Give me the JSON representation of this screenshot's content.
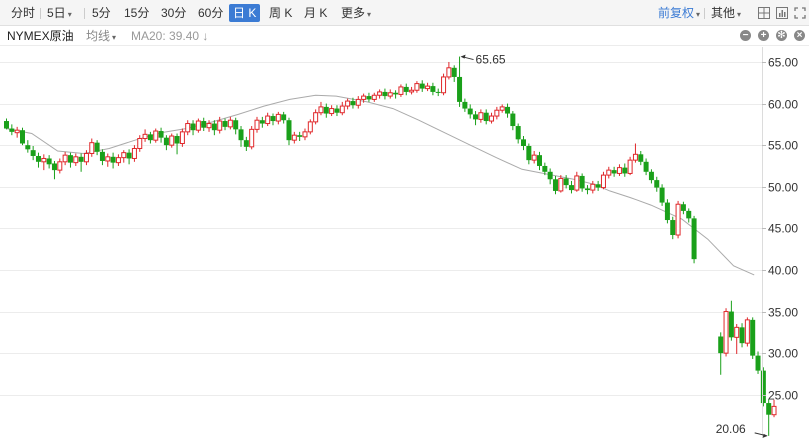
{
  "toolbar": {
    "periods": [
      "分时",
      "5日",
      "5分",
      "15分",
      "30分",
      "60分",
      "日 K",
      "周 K",
      "月 K",
      "更多"
    ],
    "active_period": "日 K",
    "adjust_label": "前复权",
    "other_label": "其他"
  },
  "legend": {
    "symbol": "NYMEX原油",
    "indicator": "均线",
    "ma_label": "MA20: 39.40 ↓"
  },
  "colors": {
    "up": "#e0272a",
    "down": "#1aa01a",
    "ma": "#aaaaaa",
    "accent": "#3b7bd4"
  },
  "chart_data": {
    "type": "candlestick",
    "y_ticks": [
      "65.00",
      "60.00",
      "55.00",
      "50.00",
      "45.00",
      "40.00",
      "35.00",
      "30.00",
      "25.00"
    ],
    "ylim": [
      19.8,
      66.8
    ],
    "grid": true,
    "annotations": {
      "max_label": "65.65",
      "min_label": "20.06"
    },
    "candles": [
      [
        57.9,
        57.0,
        58.2,
        56.9
      ],
      [
        57.0,
        56.6,
        57.5,
        56.2
      ],
      [
        56.5,
        56.8,
        57.2,
        55.9
      ],
      [
        56.8,
        55.2,
        57.1,
        55.0
      ],
      [
        55.0,
        54.5,
        55.6,
        54.1
      ],
      [
        54.4,
        53.7,
        54.9,
        53.2
      ],
      [
        53.7,
        53.0,
        54.1,
        52.3
      ],
      [
        53.0,
        53.4,
        53.9,
        52.0
      ],
      [
        53.4,
        52.7,
        53.8,
        52.2
      ],
      [
        52.8,
        52.0,
        53.1,
        50.9
      ],
      [
        52.0,
        53.0,
        53.4,
        51.6
      ],
      [
        53.0,
        53.8,
        54.2,
        52.6
      ],
      [
        53.8,
        52.9,
        54.1,
        52.3
      ],
      [
        52.9,
        53.6,
        54.0,
        52.5
      ],
      [
        53.6,
        53.0,
        54.0,
        51.8
      ],
      [
        53.0,
        54.0,
        54.4,
        52.6
      ],
      [
        54.0,
        55.3,
        55.8,
        53.6
      ],
      [
        55.3,
        54.2,
        55.6,
        53.8
      ],
      [
        54.2,
        53.1,
        54.5,
        52.6
      ],
      [
        53.1,
        53.6,
        54.0,
        52.4
      ],
      [
        53.6,
        52.9,
        54.1,
        52.2
      ],
      [
        52.9,
        53.5,
        53.9,
        52.5
      ],
      [
        53.5,
        54.1,
        54.4,
        52.9
      ],
      [
        54.1,
        53.4,
        54.5,
        52.7
      ],
      [
        53.4,
        54.6,
        55.0,
        53.0
      ],
      [
        54.6,
        55.8,
        56.2,
        54.2
      ],
      [
        55.8,
        56.3,
        56.9,
        55.4
      ],
      [
        56.3,
        55.6,
        56.6,
        55.2
      ],
      [
        55.6,
        56.7,
        57.0,
        55.3
      ],
      [
        56.7,
        55.9,
        57.1,
        55.3
      ],
      [
        55.9,
        55.0,
        56.2,
        54.4
      ],
      [
        55.0,
        56.1,
        56.4,
        54.7
      ],
      [
        56.1,
        55.2,
        56.4,
        53.9
      ],
      [
        55.2,
        56.6,
        57.0,
        54.8
      ],
      [
        56.6,
        57.6,
        58.0,
        56.2
      ],
      [
        57.6,
        56.8,
        58.0,
        56.2
      ],
      [
        56.8,
        57.9,
        58.2,
        56.5
      ],
      [
        57.9,
        57.1,
        58.3,
        56.7
      ],
      [
        57.1,
        57.6,
        58.0,
        56.6
      ],
      [
        57.6,
        56.8,
        58.0,
        56.2
      ],
      [
        56.8,
        57.9,
        58.4,
        56.4
      ],
      [
        57.9,
        57.2,
        58.2,
        56.8
      ],
      [
        57.2,
        58.0,
        58.4,
        56.9
      ],
      [
        58.0,
        56.9,
        58.3,
        56.3
      ],
      [
        56.9,
        55.6,
        57.3,
        54.8
      ],
      [
        55.6,
        54.8,
        56.0,
        54.3
      ],
      [
        54.8,
        56.9,
        57.3,
        54.5
      ],
      [
        56.9,
        58.0,
        58.4,
        56.5
      ],
      [
        58.0,
        57.6,
        58.4,
        57.1
      ],
      [
        57.6,
        58.5,
        58.9,
        57.3
      ],
      [
        58.5,
        57.9,
        58.8,
        57.4
      ],
      [
        57.9,
        58.7,
        59.0,
        57.5
      ],
      [
        58.7,
        58.0,
        59.0,
        57.6
      ],
      [
        58.0,
        55.6,
        58.3,
        55.0
      ],
      [
        55.6,
        56.2,
        56.6,
        55.2
      ],
      [
        56.2,
        56.0,
        56.6,
        55.5
      ],
      [
        56.0,
        56.6,
        57.0,
        55.6
      ],
      [
        56.6,
        57.8,
        58.1,
        56.3
      ],
      [
        57.8,
        58.9,
        59.3,
        57.5
      ],
      [
        58.9,
        59.6,
        60.2,
        58.6
      ],
      [
        59.6,
        58.8,
        60.0,
        58.3
      ],
      [
        58.8,
        59.4,
        59.8,
        58.5
      ],
      [
        59.4,
        58.9,
        59.8,
        58.5
      ],
      [
        58.9,
        59.7,
        60.2,
        58.6
      ],
      [
        59.7,
        60.3,
        60.6,
        59.3
      ],
      [
        60.3,
        59.8,
        60.7,
        59.4
      ],
      [
        59.8,
        60.5,
        60.9,
        59.4
      ],
      [
        60.5,
        60.9,
        61.2,
        60.1
      ],
      [
        60.9,
        60.5,
        61.3,
        60.2
      ],
      [
        60.5,
        61.0,
        61.3,
        60.2
      ],
      [
        61.0,
        61.4,
        61.7,
        60.6
      ],
      [
        61.4,
        60.9,
        61.8,
        60.5
      ],
      [
        60.9,
        61.3,
        61.7,
        60.6
      ],
      [
        61.3,
        61.1,
        61.6,
        60.6
      ],
      [
        61.1,
        62.0,
        62.3,
        60.8
      ],
      [
        62.0,
        61.4,
        62.4,
        61.0
      ],
      [
        61.4,
        61.6,
        62.0,
        61.1
      ],
      [
        61.6,
        62.4,
        62.7,
        61.3
      ],
      [
        62.4,
        61.8,
        62.8,
        61.4
      ],
      [
        61.8,
        62.1,
        62.5,
        61.5
      ],
      [
        62.1,
        61.4,
        62.5,
        61.0
      ],
      [
        61.4,
        61.3,
        61.8,
        60.9
      ],
      [
        61.3,
        63.2,
        63.6,
        61.0
      ],
      [
        63.2,
        64.3,
        65.0,
        62.9
      ],
      [
        64.3,
        63.2,
        64.6,
        62.6
      ],
      [
        63.2,
        60.2,
        65.65,
        59.6
      ],
      [
        60.2,
        59.4,
        60.6,
        59.0
      ],
      [
        59.4,
        58.7,
        59.9,
        58.2
      ],
      [
        58.7,
        58.1,
        59.1,
        57.4
      ],
      [
        58.1,
        58.9,
        59.3,
        57.7
      ],
      [
        58.9,
        57.9,
        59.3,
        57.5
      ],
      [
        57.9,
        58.5,
        58.9,
        57.6
      ],
      [
        58.5,
        59.2,
        59.6,
        58.1
      ],
      [
        59.2,
        59.6,
        59.9,
        58.9
      ],
      [
        59.6,
        58.8,
        60.0,
        58.3
      ],
      [
        58.8,
        57.3,
        59.1,
        56.8
      ],
      [
        57.3,
        55.7,
        57.6,
        55.2
      ],
      [
        55.7,
        54.9,
        56.1,
        54.4
      ],
      [
        54.9,
        53.2,
        55.2,
        52.7
      ],
      [
        53.2,
        53.8,
        54.3,
        52.8
      ],
      [
        53.8,
        52.5,
        54.2,
        52.0
      ],
      [
        52.5,
        51.8,
        52.9,
        51.4
      ],
      [
        51.8,
        50.9,
        52.2,
        50.3
      ],
      [
        50.9,
        49.5,
        51.3,
        49.1
      ],
      [
        49.5,
        51.0,
        51.4,
        49.3
      ],
      [
        51.0,
        50.2,
        51.4,
        49.8
      ],
      [
        50.2,
        49.6,
        50.7,
        49.2
      ],
      [
        49.6,
        51.3,
        51.8,
        49.4
      ],
      [
        51.3,
        49.8,
        51.6,
        49.4
      ],
      [
        49.8,
        49.6,
        50.2,
        49.1
      ],
      [
        49.6,
        50.3,
        50.7,
        49.2
      ],
      [
        50.3,
        49.9,
        50.7,
        49.5
      ],
      [
        49.9,
        51.4,
        51.8,
        49.7
      ],
      [
        51.4,
        52.0,
        52.4,
        51.0
      ],
      [
        52.0,
        51.6,
        52.4,
        51.2
      ],
      [
        51.6,
        52.3,
        52.7,
        51.3
      ],
      [
        52.3,
        51.6,
        52.8,
        51.2
      ],
      [
        51.6,
        53.2,
        53.6,
        51.4
      ],
      [
        53.2,
        53.9,
        55.2,
        52.9
      ],
      [
        53.9,
        53.0,
        54.3,
        52.6
      ],
      [
        53.0,
        51.8,
        53.4,
        51.4
      ],
      [
        51.8,
        50.8,
        52.1,
        50.4
      ],
      [
        50.8,
        49.9,
        51.2,
        49.4
      ],
      [
        49.9,
        48.1,
        50.3,
        47.7
      ],
      [
        48.1,
        46.0,
        48.5,
        45.6
      ],
      [
        46.0,
        44.2,
        46.4,
        43.7
      ],
      [
        44.2,
        47.9,
        48.3,
        43.8
      ],
      [
        47.9,
        47.1,
        48.2,
        46.7
      ],
      [
        47.1,
        46.2,
        47.4,
        45.7
      ],
      [
        46.2,
        41.3,
        46.5,
        40.8
      ],
      null,
      null,
      null,
      null,
      [
        32.0,
        30.0,
        32.5,
        27.4
      ],
      [
        30.0,
        35.0,
        35.4,
        29.6
      ],
      [
        35.0,
        31.9,
        36.3,
        31.5
      ],
      [
        31.9,
        33.1,
        33.5,
        29.9
      ],
      [
        33.1,
        31.2,
        33.6,
        30.7
      ],
      [
        31.2,
        34.0,
        34.3,
        30.8
      ],
      [
        34.0,
        29.7,
        34.3,
        29.3
      ],
      [
        29.7,
        27.9,
        30.2,
        27.5
      ],
      [
        27.9,
        24.0,
        28.3,
        23.6
      ],
      [
        24.0,
        22.6,
        24.5,
        20.06
      ],
      [
        22.6,
        23.6,
        24.4,
        22.3
      ]
    ],
    "ma20": [
      [
        0,
        57.0
      ],
      [
        10,
        56.4
      ],
      [
        20,
        54.3
      ],
      [
        30,
        54.0
      ],
      [
        40,
        54.6
      ],
      [
        50,
        55.6
      ],
      [
        60,
        56.5
      ],
      [
        70,
        57.0
      ],
      [
        80,
        57.8
      ],
      [
        90,
        58.7
      ],
      [
        100,
        59.7
      ],
      [
        110,
        60.5
      ],
      [
        120,
        61.0
      ],
      [
        128,
        60.9
      ],
      [
        140,
        60.2
      ],
      [
        150,
        59.4
      ],
      [
        160,
        58.0
      ],
      [
        170,
        56.5
      ],
      [
        180,
        55.0
      ],
      [
        190,
        53.5
      ],
      [
        200,
        52.1
      ],
      [
        210,
        51.5
      ],
      [
        220,
        50.9
      ],
      [
        228,
        50.3
      ],
      [
        234,
        49.5
      ],
      [
        242,
        48.7
      ],
      [
        250,
        47.8
      ],
      [
        262,
        46.1
      ],
      [
        272,
        43.7
      ],
      [
        282,
        40.5
      ],
      [
        290,
        39.4
      ]
    ]
  }
}
